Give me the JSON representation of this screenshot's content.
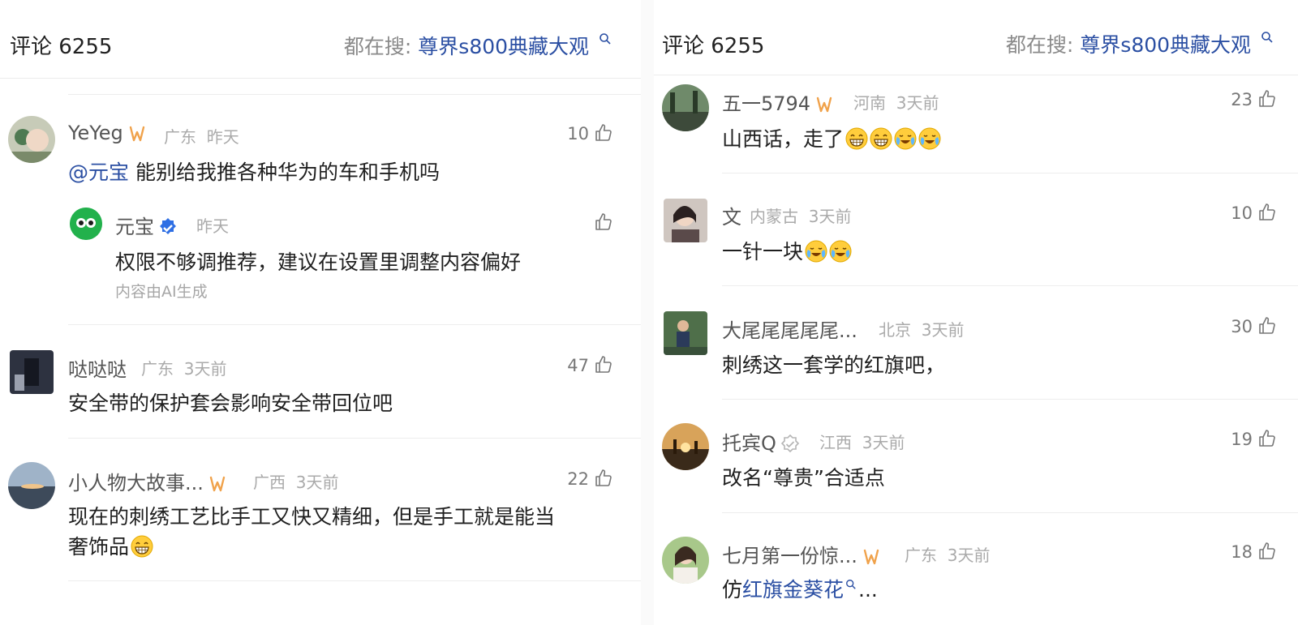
{
  "left": {
    "header": {
      "title": "评论 6255",
      "search_label": "都在搜:",
      "search_term": "尊界s800典藏大观"
    },
    "comments": [
      {
        "name": "YeYeg",
        "region": "广东",
        "time": "昨天",
        "likes": "10",
        "mention": "@元宝",
        "text": "能别给我推各种华为的车和手机吗",
        "reply": {
          "name": "元宝",
          "time": "昨天",
          "text": "权限不够调推荐，建议在设置里调整内容偏好",
          "note": "内容由AI生成"
        }
      },
      {
        "name": "哒哒哒",
        "region": "广东",
        "time": "3天前",
        "likes": "47",
        "text": "安全带的保护套会影响安全带回位吧"
      },
      {
        "name": "小人物大故事...",
        "region": "广西",
        "time": "3天前",
        "likes": "22",
        "text_line1": "现在的刺绣工艺比手工又快又精细，但是手工就是能当",
        "text_line2": "奢饰品"
      }
    ]
  },
  "right": {
    "header": {
      "title": "评论 6255",
      "search_label": "都在搜:",
      "search_term": "尊界s800典藏大观"
    },
    "comments": [
      {
        "name": "五一5794",
        "region": "河南",
        "time": "3天前",
        "likes": "23",
        "text": "山西话，走了"
      },
      {
        "name": "文",
        "region": "内蒙古",
        "time": "3天前",
        "likes": "10",
        "text": "一针一块"
      },
      {
        "name": "大尾尾尾尾尾...",
        "region": "北京",
        "time": "3天前",
        "likes": "30",
        "text": "刺绣这一套学的红旗吧，"
      },
      {
        "name": "托宾Q",
        "region": "江西",
        "time": "3天前",
        "likes": "19",
        "text": "改名“尊贵”合适点"
      },
      {
        "name": "七月第一份惊...",
        "region": "广东",
        "time": "3天前",
        "likes": "18",
        "text_prefix": "仿",
        "text_link": "红旗金葵花",
        "text_suffix": "..."
      }
    ]
  },
  "colors": {
    "link": "#2b4fa3",
    "badge": "#f0a24b",
    "verified": "#2f6fe4",
    "ai_logo": "#22b14c"
  }
}
